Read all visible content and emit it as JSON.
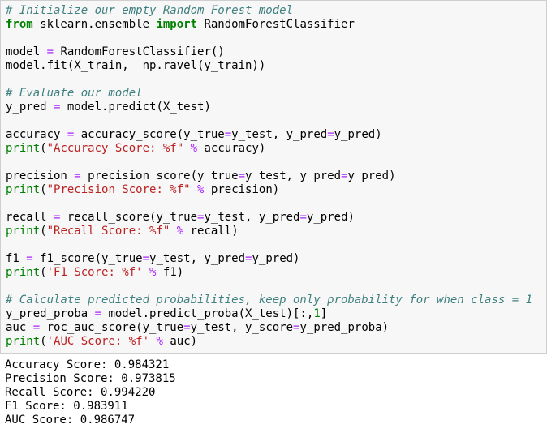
{
  "colors": {
    "comment": "#408080",
    "keyword": "#008000",
    "builtin": "#008000",
    "operator": "#aa22ff",
    "string": "#ba2121",
    "number": "#008000",
    "text": "#000000",
    "cell_background": "#f7f7f7",
    "cell_border": "#cfcfcf"
  },
  "code_lines": [
    [
      {
        "t": "comment",
        "v": "# Initialize our empty Random Forest model"
      }
    ],
    [
      {
        "t": "kw",
        "v": "from"
      },
      {
        "t": "plain",
        "v": " sklearn.ensemble "
      },
      {
        "t": "kw",
        "v": "import"
      },
      {
        "t": "plain",
        "v": " RandomForestClassifier"
      }
    ],
    [],
    [
      {
        "t": "plain",
        "v": "model "
      },
      {
        "t": "op",
        "v": "="
      },
      {
        "t": "plain",
        "v": " RandomForestClassifier()"
      }
    ],
    [
      {
        "t": "plain",
        "v": "model.fit(X_train,  np.ravel(y_train))"
      }
    ],
    [],
    [
      {
        "t": "comment",
        "v": "# Evaluate our model"
      }
    ],
    [
      {
        "t": "plain",
        "v": "y_pred "
      },
      {
        "t": "op",
        "v": "="
      },
      {
        "t": "plain",
        "v": " model.predict(X_test)"
      }
    ],
    [],
    [
      {
        "t": "plain",
        "v": "accuracy "
      },
      {
        "t": "op",
        "v": "="
      },
      {
        "t": "plain",
        "v": " accuracy_score(y_true"
      },
      {
        "t": "op",
        "v": "="
      },
      {
        "t": "plain",
        "v": "y_test, y_pred"
      },
      {
        "t": "op",
        "v": "="
      },
      {
        "t": "plain",
        "v": "y_pred)"
      }
    ],
    [
      {
        "t": "builtin",
        "v": "print"
      },
      {
        "t": "plain",
        "v": "("
      },
      {
        "t": "str",
        "v": "\"Accuracy Score: %f\""
      },
      {
        "t": "plain",
        "v": " "
      },
      {
        "t": "op",
        "v": "%"
      },
      {
        "t": "plain",
        "v": " accuracy)"
      }
    ],
    [],
    [
      {
        "t": "plain",
        "v": "precision "
      },
      {
        "t": "op",
        "v": "="
      },
      {
        "t": "plain",
        "v": " precision_score(y_true"
      },
      {
        "t": "op",
        "v": "="
      },
      {
        "t": "plain",
        "v": "y_test, y_pred"
      },
      {
        "t": "op",
        "v": "="
      },
      {
        "t": "plain",
        "v": "y_pred)"
      }
    ],
    [
      {
        "t": "builtin",
        "v": "print"
      },
      {
        "t": "plain",
        "v": "("
      },
      {
        "t": "str",
        "v": "\"Precision Score: %f\""
      },
      {
        "t": "plain",
        "v": " "
      },
      {
        "t": "op",
        "v": "%"
      },
      {
        "t": "plain",
        "v": " precision)"
      }
    ],
    [],
    [
      {
        "t": "plain",
        "v": "recall "
      },
      {
        "t": "op",
        "v": "="
      },
      {
        "t": "plain",
        "v": " recall_score(y_true"
      },
      {
        "t": "op",
        "v": "="
      },
      {
        "t": "plain",
        "v": "y_test, y_pred"
      },
      {
        "t": "op",
        "v": "="
      },
      {
        "t": "plain",
        "v": "y_pred)"
      }
    ],
    [
      {
        "t": "builtin",
        "v": "print"
      },
      {
        "t": "plain",
        "v": "("
      },
      {
        "t": "str",
        "v": "\"Recall Score: %f\""
      },
      {
        "t": "plain",
        "v": " "
      },
      {
        "t": "op",
        "v": "%"
      },
      {
        "t": "plain",
        "v": " recall)"
      }
    ],
    [],
    [
      {
        "t": "plain",
        "v": "f1 "
      },
      {
        "t": "op",
        "v": "="
      },
      {
        "t": "plain",
        "v": " f1_score(y_true"
      },
      {
        "t": "op",
        "v": "="
      },
      {
        "t": "plain",
        "v": "y_test, y_pred"
      },
      {
        "t": "op",
        "v": "="
      },
      {
        "t": "plain",
        "v": "y_pred)"
      }
    ],
    [
      {
        "t": "builtin",
        "v": "print"
      },
      {
        "t": "plain",
        "v": "("
      },
      {
        "t": "str",
        "v": "'F1 Score: %f'"
      },
      {
        "t": "plain",
        "v": " "
      },
      {
        "t": "op",
        "v": "%"
      },
      {
        "t": "plain",
        "v": " f1)"
      }
    ],
    [],
    [
      {
        "t": "comment",
        "v": "# Calculate predicted probabilities, keep only probability for when class = 1"
      }
    ],
    [
      {
        "t": "plain",
        "v": "y_pred_proba "
      },
      {
        "t": "op",
        "v": "="
      },
      {
        "t": "plain",
        "v": " model.predict_proba(X_test)[:,"
      },
      {
        "t": "num",
        "v": "1"
      },
      {
        "t": "plain",
        "v": "]"
      }
    ],
    [
      {
        "t": "plain",
        "v": "auc "
      },
      {
        "t": "op",
        "v": "="
      },
      {
        "t": "plain",
        "v": " roc_auc_score(y_true"
      },
      {
        "t": "op",
        "v": "="
      },
      {
        "t": "plain",
        "v": "y_test, y_score"
      },
      {
        "t": "op",
        "v": "="
      },
      {
        "t": "plain",
        "v": "y_pred_proba)"
      }
    ],
    [
      {
        "t": "builtin",
        "v": "print"
      },
      {
        "t": "plain",
        "v": "("
      },
      {
        "t": "str",
        "v": "'AUC Score: %f'"
      },
      {
        "t": "plain",
        "v": " "
      },
      {
        "t": "op",
        "v": "%"
      },
      {
        "t": "plain",
        "v": " auc)"
      }
    ]
  ],
  "output_lines": [
    "Accuracy Score: 0.984321",
    "Precision Score: 0.973815",
    "Recall Score: 0.994220",
    "F1 Score: 0.983911",
    "AUC Score: 0.986747"
  ]
}
